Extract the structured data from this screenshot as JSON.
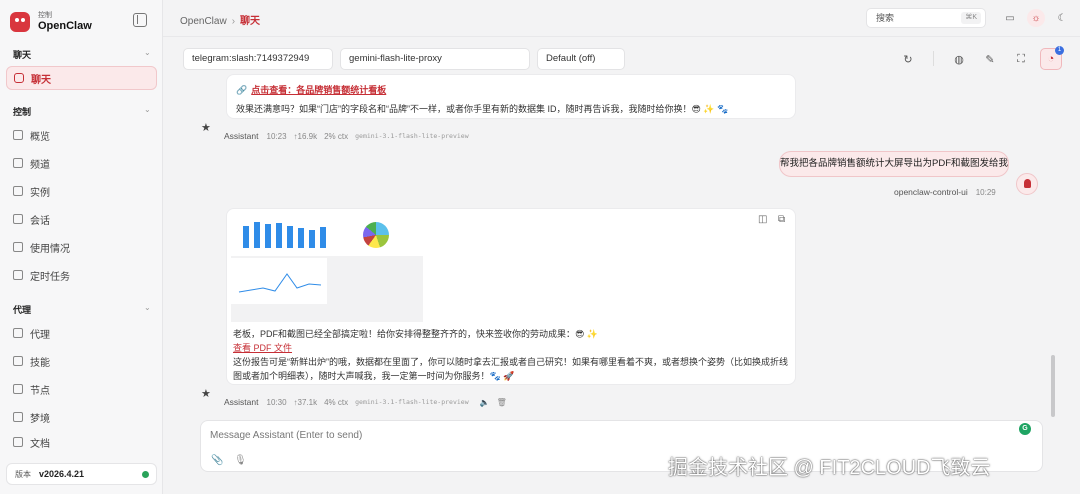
{
  "brand": {
    "small": "控制",
    "name": "OpenClaw"
  },
  "sidebar": {
    "sections": [
      {
        "title": "聊天",
        "items": [
          {
            "label": "聊天",
            "icon": "chat-icon",
            "active": true
          }
        ]
      },
      {
        "title": "控制",
        "items": [
          {
            "label": "概览",
            "icon": "chart-icon"
          },
          {
            "label": "频道",
            "icon": "link-icon"
          },
          {
            "label": "实例",
            "icon": "radio-icon"
          },
          {
            "label": "会话",
            "icon": "document-icon"
          },
          {
            "label": "使用情况",
            "icon": "bar-chart-icon"
          },
          {
            "label": "定时任务",
            "icon": "loader-icon"
          }
        ]
      },
      {
        "title": "代理",
        "items": [
          {
            "label": "代理",
            "icon": "folder-icon"
          },
          {
            "label": "技能",
            "icon": "zap-icon"
          },
          {
            "label": "节点",
            "icon": "monitor-icon"
          },
          {
            "label": "梦境",
            "icon": "moon-icon"
          },
          {
            "label": "文档",
            "icon": "book-icon"
          }
        ]
      }
    ],
    "version_label": "版本",
    "version_value": "v2026.4.21",
    "status_color": "#29a35a"
  },
  "topbar": {
    "crumb_root": "OpenClaw",
    "crumb_sep": "›",
    "crumb_current": "聊天",
    "search_label": "搜索",
    "search_kbd": "⌘K"
  },
  "session": {
    "channel": "telegram:slash:7149372949",
    "model": "gemini-flash-lite-proxy",
    "mode": "Default (off)",
    "badge": "1"
  },
  "messages": {
    "m1": {
      "link_text": "点击查看：各品牌销售额统计看板",
      "body": "效果还满意吗？如果“门店”的字段名和“品牌”不一样，或者你手里有新的数据集 ID，随时再告诉我，我随时给你换！😎 ✨ 🐾",
      "who": "Assistant",
      "time": "10:23",
      "tokens": "↑16.9k",
      "ctx": "2% ctx",
      "model": "gemini-3.1-flash-lite-preview"
    },
    "user": {
      "text": "帮我把各品牌销售额统计大屏导出为PDF和截图发给我",
      "who": "openclaw-control-ui",
      "time": "10:29"
    },
    "m2": {
      "line1": "老板，PDF和截图已经全部搞定啦！给你安排得整整齐齐的，快来签收你的劳动成果：😎 ✨",
      "link_text": "查看 PDF 文件",
      "line2": "这份报告可是“新鲜出炉”的哦，数据都在里面了，你可以随时拿去汇报或者自己研究！如果有哪里看着不爽，或者想换个姿势（比如换成折线图或者加个明细表），随时大声喊我，我一定第一时间为你服务！🐾 🚀",
      "who": "Assistant",
      "time": "10:30",
      "tokens": "↑37.1k",
      "ctx": "4% ctx",
      "model": "gemini-3.1-flash-lite-preview"
    }
  },
  "composer": {
    "placeholder": "Message Assistant (Enter to send)"
  },
  "watermark": "掘金技术社区 @ FIT2CLOUD飞致云",
  "colors": {
    "accent": "#c62f36",
    "accent_bg": "#fbe9ea"
  }
}
